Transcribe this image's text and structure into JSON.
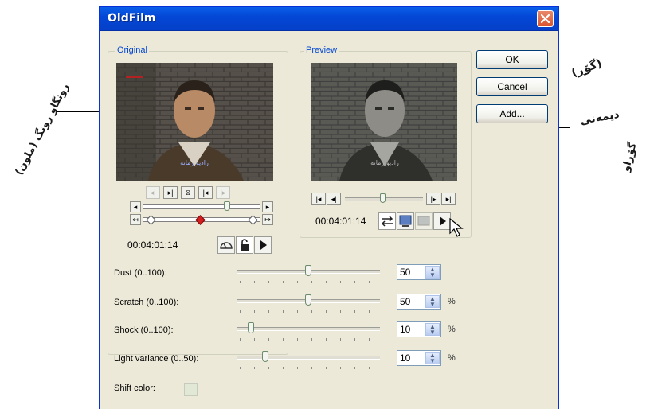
{
  "window": {
    "title": "OldFilm",
    "close_glyph": "✕"
  },
  "panels": {
    "original": {
      "legend": "Original",
      "timecode": "00:04:01:14",
      "subtitle_caption": "رادیو زمانه"
    },
    "preview": {
      "legend": "Preview",
      "timecode": "00:04:01:14",
      "subtitle_caption": "رادیو زمانه"
    }
  },
  "buttons": {
    "ok": "OK",
    "cancel": "Cancel",
    "add": "Add..."
  },
  "params": [
    {
      "label": "Dust (0..100):",
      "value": "50",
      "unit": "",
      "level": 0.5
    },
    {
      "label": "Scratch (0..100):",
      "value": "50",
      "unit": "%",
      "level": 0.5
    },
    {
      "label": "Shock (0..100):",
      "value": "10",
      "unit": "%",
      "level": 0.1
    },
    {
      "label": "Light variance (0..50):",
      "value": "10",
      "unit": "%",
      "level": 0.2
    }
  ],
  "shift_color": {
    "label": "Shift color:"
  },
  "annotations": {
    "left": "رونگاو رونگ (ملون)",
    "right_1": "(گۆڕ)",
    "right_2": "دیمەنی",
    "right_3": "گۆڕاو"
  },
  "icons": {
    "play": "play-icon",
    "lock": "lock-icon",
    "compare": "compare-icon"
  },
  "colors": {
    "titlebar": "#0A5FE8",
    "dialog": "#ECE9D8",
    "accent": "#0046D5"
  }
}
